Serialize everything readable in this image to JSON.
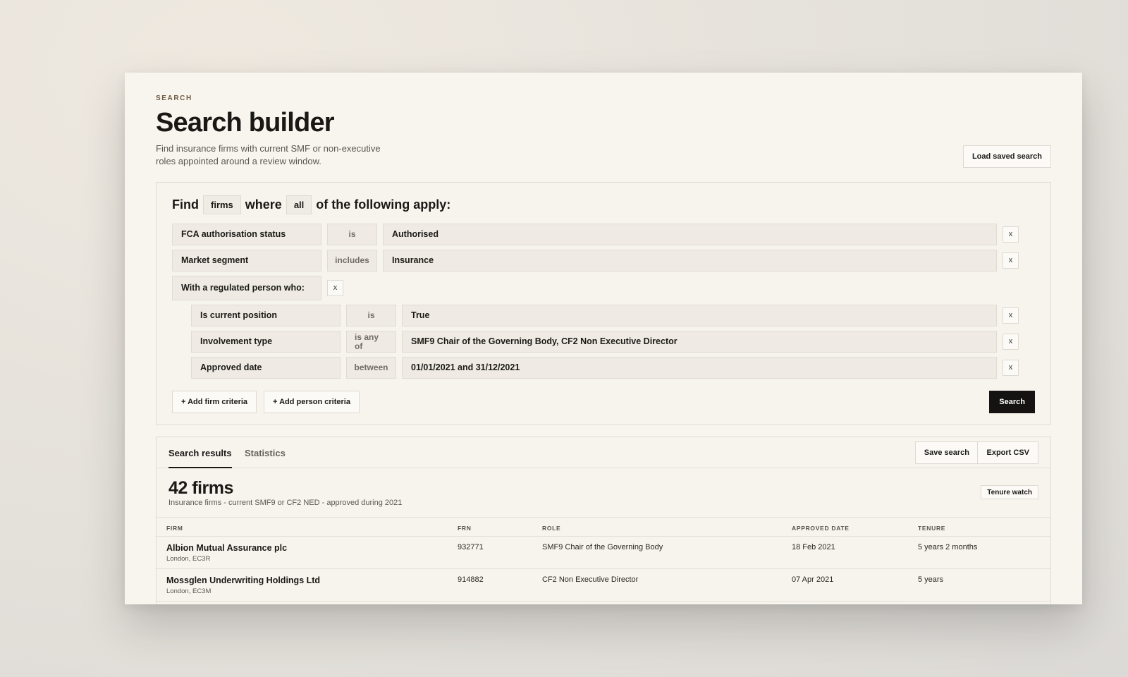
{
  "header": {
    "eyebrow": "SEARCH",
    "title": "Search builder",
    "subtitle": "Find insurance firms with current SMF or non-executive roles appointed around a review window.",
    "load_saved": "Load saved search"
  },
  "builder": {
    "find": "Find",
    "entity": "firms",
    "where": "where",
    "quantifier": "all",
    "following": "of the following apply:",
    "rows": [
      {
        "field": "FCA authorisation status",
        "op": "is",
        "value": "Authorised"
      },
      {
        "field": "Market segment",
        "op": "includes",
        "value": "Insurance"
      }
    ],
    "group": {
      "label": "With a regulated person who:",
      "rows": [
        {
          "field": "Is current position",
          "op": "is",
          "value": "True"
        },
        {
          "field": "Involvement type",
          "op_line1": "is any",
          "op_line2": "of",
          "value": "SMF9 Chair of the Governing Body, CF2 Non Executive Director"
        },
        {
          "field": "Approved date",
          "op": "between",
          "value": "01/01/2021 and 31/12/2021"
        }
      ]
    },
    "remove": "x",
    "add_firm": "+ Add firm criteria",
    "add_person": "+ Add person criteria",
    "search": "Search"
  },
  "results": {
    "tabs": [
      "Search results",
      "Statistics"
    ],
    "save_search": "Save search",
    "export_csv": "Export CSV",
    "count": "42 firms",
    "summary": "Insurance firms - current SMF9 or CF2 NED - approved during 2021",
    "tenure_watch": "Tenure watch",
    "columns": [
      "FIRM",
      "FRN",
      "ROLE",
      "APPROVED DATE",
      "TENURE"
    ],
    "rows": [
      {
        "firm": "Albion Mutual Assurance plc",
        "location": "London, EC3R",
        "frn": "932771",
        "role": "SMF9 Chair of the Governing Body",
        "approved": "18 Feb 2021",
        "tenure": "5 years 2 months"
      },
      {
        "firm": "Mossglen Underwriting Holdings Ltd",
        "location": "London, EC3M",
        "frn": "914882",
        "role": "CF2 Non Executive Director",
        "approved": "07 Apr 2021",
        "tenure": "5 years"
      }
    ]
  }
}
